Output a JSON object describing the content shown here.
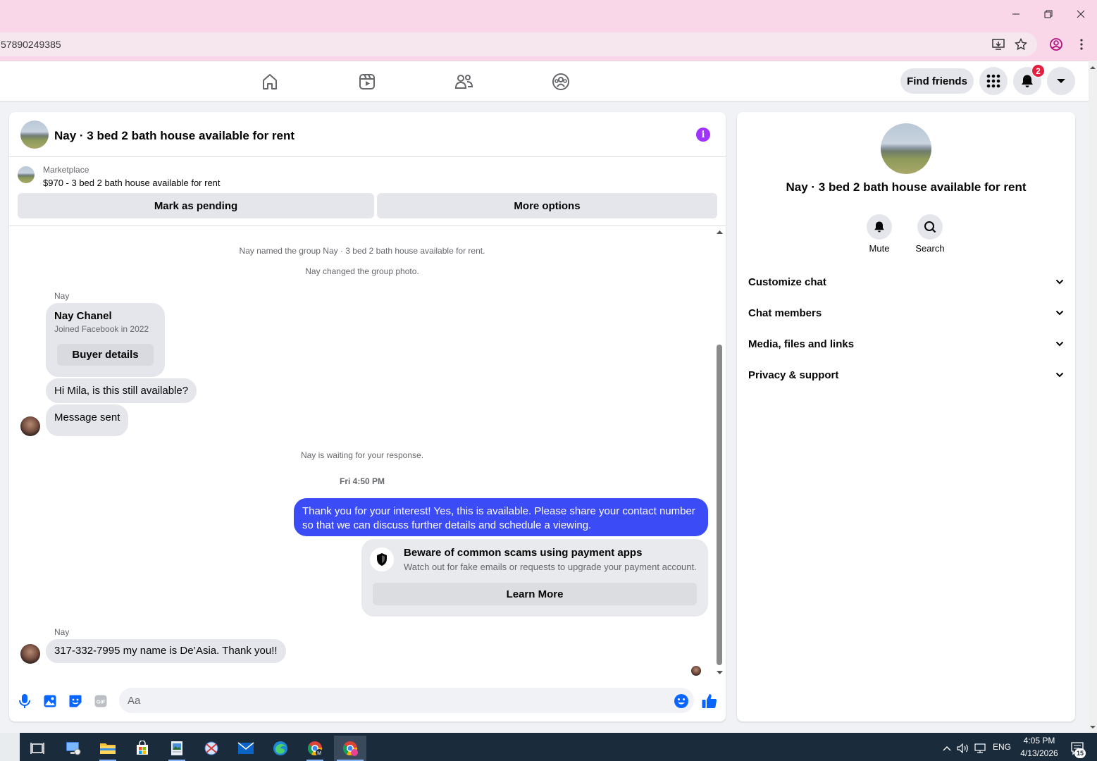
{
  "browser": {
    "url": "57890249385",
    "window_buttons": [
      "minimize",
      "restore",
      "close"
    ]
  },
  "topnav": {
    "find_friends": "Find friends",
    "notification_count": "2",
    "icons": [
      "home-icon",
      "video-icon",
      "friends-icon",
      "groups-icon"
    ]
  },
  "chat": {
    "title": "Nay · 3 bed 2 bath house available for rent",
    "marketplace_label": "Marketplace",
    "listing": "$970 - 3 bed 2 bath house available for rent",
    "mark_pending": "Mark as pending",
    "more_options": "More options",
    "system_messages": [
      "Nay named the group Nay · 3 bed 2 bath house available for rent.",
      "Nay changed the group photo."
    ],
    "sender_name": "Nay",
    "buyer_card": {
      "name": "Nay Chanel",
      "joined": "Joined Facebook in 2022",
      "button": "Buyer details"
    },
    "msg1": "Hi Mila, is this still available?",
    "msg2": "Message sent",
    "waiting": "Nay is waiting for your response.",
    "timestamp": "Fri 4:50 PM",
    "reply": "Thank you for your interest! Yes, this is available. Please share your contact number so that we can discuss further details and schedule a viewing.",
    "scam": {
      "title": "Beware of common scams using payment apps",
      "desc": "Watch out for fake emails or requests to upgrade your payment account.",
      "button": "Learn More"
    },
    "sender_name2": "Nay",
    "msg3": "317-332-7995 my name is De’Asia. Thank you!!",
    "input_placeholder": "Aa"
  },
  "info_panel": {
    "title": "Nay · 3 bed 2 bath house available for rent",
    "mute": "Mute",
    "search": "Search",
    "sections": [
      "Customize chat",
      "Chat members",
      "Media, files and links",
      "Privacy & support"
    ]
  },
  "taskbar": {
    "language": "ENG",
    "time": "4:05 PM",
    "date": "4/13/2026",
    "notif_count": "15"
  },
  "colors": {
    "accent_blue": "#3b4bf6",
    "info_purple": "#a033ff",
    "badge_red": "#e41e3f",
    "chrome_pink": "#fad6e9"
  }
}
